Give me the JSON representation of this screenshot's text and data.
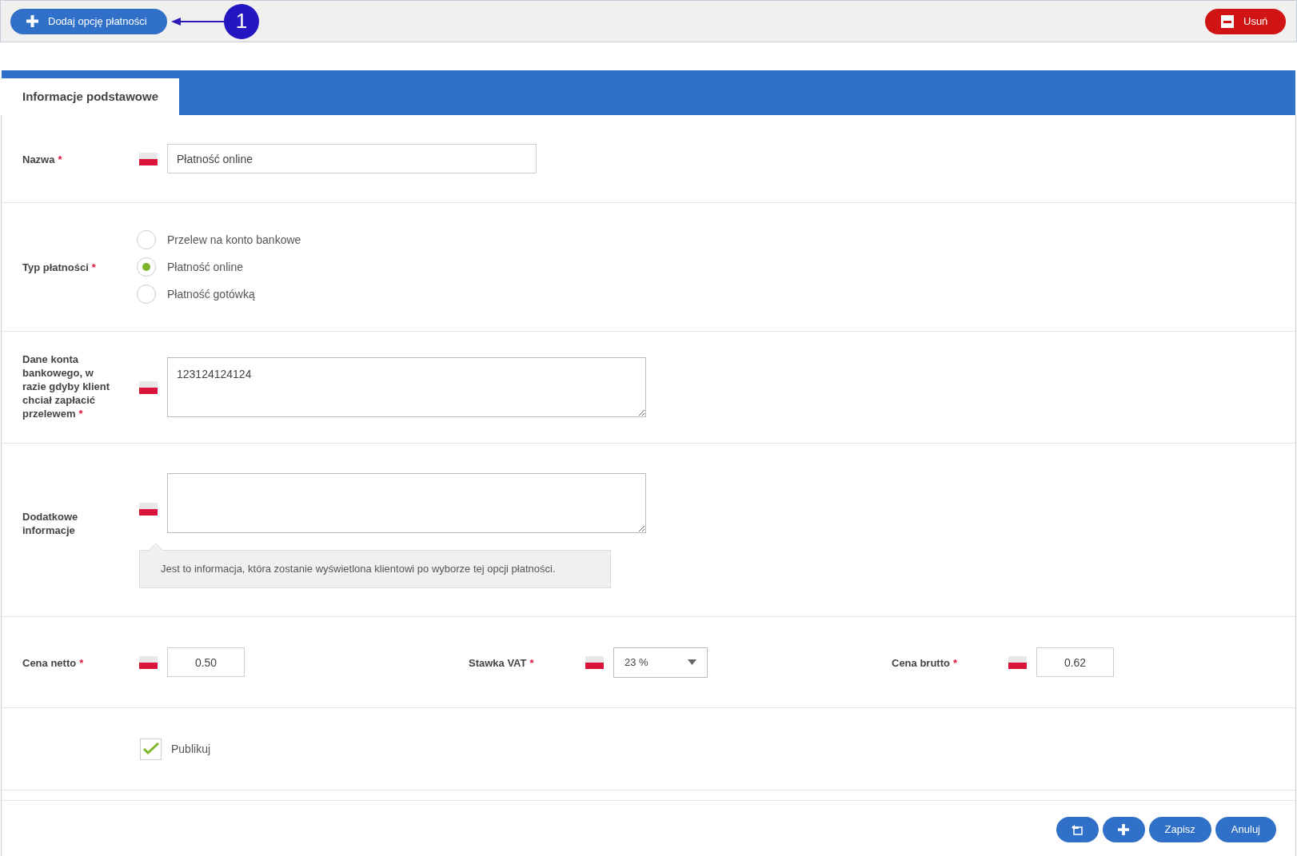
{
  "toolbar": {
    "add_button": "Dodaj opcję płatności",
    "annotation": "1",
    "delete_button": "Usuń"
  },
  "tabs": [
    {
      "label": "Informacje podstawowe",
      "selected": true
    }
  ],
  "form": {
    "name": {
      "label": "Nazwa",
      "asterisk": "*",
      "value": "Płatność online"
    },
    "payment_type": {
      "label": "Typ płatności",
      "asterisk": "*",
      "options": [
        {
          "label": "Przelew na konto bankowe",
          "selected": false
        },
        {
          "label": "Płatność online",
          "selected": true
        },
        {
          "label": "Płatność gotówką",
          "selected": false
        }
      ]
    },
    "bank_details": {
      "label": "Dane konta bankowego, w razie gdyby klient chciał zapłacić przelewem",
      "asterisk": "*",
      "value": "123124124124"
    },
    "additional_info": {
      "label": "Dodatkowe informacje",
      "hint": "Jest to informacja, która zostanie wyświetlona klientowi po wyborze tej opcji płatności."
    },
    "prices": [
      {
        "kind": "input",
        "label": "Cena netto",
        "asterisk": "*",
        "value": "0.50"
      },
      {
        "kind": "select",
        "label": "Stawka VAT",
        "asterisk": "*",
        "value": "23 %"
      },
      {
        "kind": "input",
        "label": "Cena brutto",
        "asterisk": "*",
        "value": "0.62"
      }
    ],
    "publish": {
      "label": "Publikuj",
      "checked": true
    }
  },
  "footer": {
    "buttons": [
      {
        "kind": "back"
      },
      {
        "kind": "plus"
      },
      {
        "kind": "text",
        "label": "Zapisz"
      },
      {
        "kind": "text",
        "label": "Anuluj"
      }
    ]
  }
}
